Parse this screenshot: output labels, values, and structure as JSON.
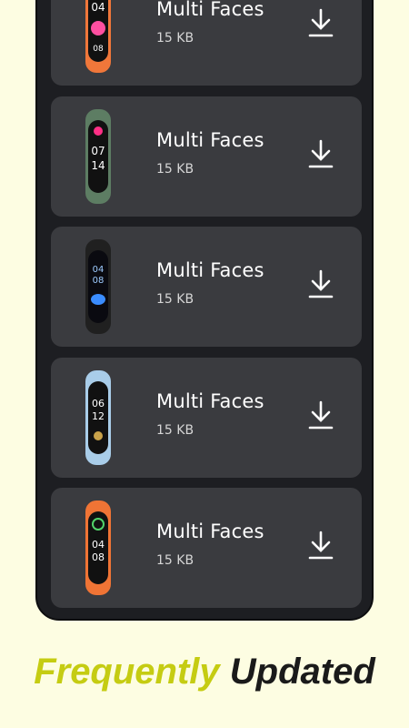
{
  "items": [
    {
      "title": "Multi Faces",
      "size": "15 KB",
      "band_color": "#f0773a",
      "time_top": "04",
      "time_bottom": "08",
      "accent": "#ff4fa0"
    },
    {
      "title": "Multi Faces",
      "size": "15 KB",
      "band_color": "#5d7d63",
      "time_top": "07",
      "time_bottom": "14",
      "accent": "#ff2f85"
    },
    {
      "title": "Multi Faces",
      "size": "15 KB",
      "band_color": "#202020",
      "time_top": "04",
      "time_bottom": "08",
      "accent": "#3a8cff"
    },
    {
      "title": "Multi Faces",
      "size": "15 KB",
      "band_color": "#a9cde9",
      "time_top": "06",
      "time_bottom": "12",
      "accent": "#c9a24a"
    },
    {
      "title": "Multi Faces",
      "size": "15 KB",
      "band_color": "#f07435",
      "time_top": "04",
      "time_bottom": "08",
      "accent": "#52d36a"
    }
  ],
  "footer": {
    "word1": "Frequently",
    "word2": "Updated"
  },
  "colors": {
    "background": "#fdfde2",
    "card": "#3a3b3f",
    "phone": "#1d1e22",
    "accent_green": "#c5cc12"
  },
  "icons": {
    "download": "download-icon"
  }
}
